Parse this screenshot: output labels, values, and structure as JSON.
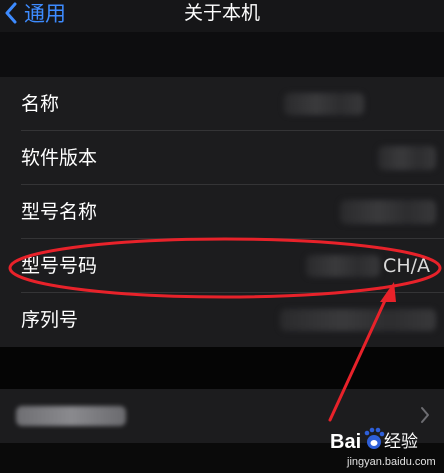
{
  "navbar": {
    "back_label": "通用",
    "title": "关于本机"
  },
  "about": {
    "rows": [
      {
        "label": "名称"
      },
      {
        "label": "软件版本"
      },
      {
        "label": "型号名称"
      },
      {
        "label": "型号号码",
        "value": "CH/A"
      },
      {
        "label": "序列号"
      }
    ]
  },
  "watermark": {
    "brand_bai": "Bai",
    "brand_du": "经验",
    "url": "jingyan.baidu.com"
  },
  "colors": {
    "accent": "#3d8bff",
    "annotation": "#e8222a",
    "cell_bg": "#1c1c1e"
  },
  "icons": [
    "chevron-left-icon",
    "chevron-right-icon",
    "baidu-paw-icon"
  ]
}
